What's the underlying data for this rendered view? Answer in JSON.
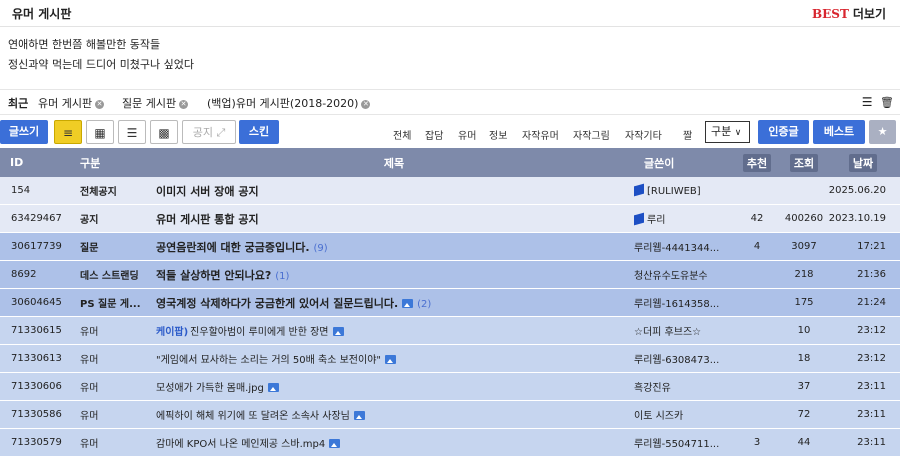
{
  "header": {
    "title": "유머 게시판",
    "best_label": "BEST",
    "more_label": "더보기"
  },
  "best_links": [
    "연애하면 한번쯤 해볼만한 동작들",
    "정신과약 먹는데 드디어 미쳤구나 싶었다"
  ],
  "recent": {
    "label": "최근",
    "tabs": [
      "유머 게시판",
      "질문 게시판",
      "(백업)유머 게시판(2018-2020)"
    ]
  },
  "toolbar": {
    "write_label": "글쓰기",
    "notice_label": "공지",
    "skin_label": "스킨",
    "categories": [
      "전체",
      "잡담",
      "유머",
      "정보",
      "자작유머",
      "자작그림",
      "자작기타",
      "짤"
    ],
    "select_value": "구분",
    "cert_label": "인증글",
    "best_label": "베스트"
  },
  "table": {
    "headers": {
      "id": "ID",
      "cat": "구분",
      "subject": "제목",
      "writer": "글쓴이",
      "recommend": "추천",
      "views": "조회",
      "date": "날짜"
    },
    "rows": [
      {
        "type": "notice",
        "id": "154",
        "cat": "전체공지",
        "tag": "",
        "subject": "이미지 서버 장애 공지",
        "comments": "",
        "image": false,
        "writer": "[RULIWEB]",
        "cube": true,
        "recommend": "",
        "views": "",
        "date": "2025.06.20"
      },
      {
        "type": "notice",
        "id": "63429467",
        "cat": "공지",
        "tag": "",
        "subject": "유머 게시판 통합 공지",
        "comments": "",
        "image": false,
        "writer": "루리",
        "cube": true,
        "recommend": "42",
        "views": "400260",
        "date": "2023.10.19"
      },
      {
        "type": "qna",
        "id": "30617739",
        "cat": "질문",
        "tag": "",
        "subject": "공연음란죄에 대한 궁금증입니다.",
        "comments": "(9)",
        "image": false,
        "writer": "루리웹-4441344...",
        "cube": false,
        "recommend": "4",
        "views": "3097",
        "date": "17:21"
      },
      {
        "type": "qna",
        "id": "8692",
        "cat": "데스 스트랜딩",
        "tag": "",
        "subject": "적들 살상하면 안되나요?",
        "comments": "(1)",
        "image": false,
        "writer": "청산유수도유분수",
        "cube": false,
        "recommend": "",
        "views": "218",
        "date": "21:36"
      },
      {
        "type": "qna",
        "id": "30604645",
        "cat": "PS 질문 게...",
        "tag": "",
        "subject": "영국계정 삭제하다가 궁금한게 있어서 질문드립니다.",
        "comments": "(2)",
        "image": true,
        "writer": "루리웹-1614358...",
        "cube": false,
        "recommend": "",
        "views": "175",
        "date": "21:24"
      },
      {
        "type": "normal",
        "id": "71330615",
        "cat": "유머",
        "tag": "케이팝)",
        "subject": "진우할아범이 루미에게 반한 장면",
        "comments": "",
        "image": true,
        "writer": "☆더피 후브즈☆",
        "cube": false,
        "recommend": "",
        "views": "10",
        "date": "23:12"
      },
      {
        "type": "normal",
        "id": "71330613",
        "cat": "유머",
        "tag": "",
        "subject": "\"게임에서 묘사하는 소리는 거의 50배 축소 보전이야\"",
        "comments": "",
        "image": true,
        "writer": "루리웹-6308473...",
        "cube": false,
        "recommend": "",
        "views": "18",
        "date": "23:12"
      },
      {
        "type": "normal",
        "id": "71330606",
        "cat": "유머",
        "tag": "",
        "subject": "모성애가 가득한 몸매.jpg",
        "comments": "",
        "image": true,
        "writer": "흑강진유",
        "cube": false,
        "recommend": "",
        "views": "37",
        "date": "23:11"
      },
      {
        "type": "normal",
        "id": "71330586",
        "cat": "유머",
        "tag": "",
        "subject": "에픽하이 해체 위기에 또 달려온 소속사 사장님",
        "comments": "",
        "image": true,
        "writer": "이토 시즈카",
        "cube": false,
        "recommend": "",
        "views": "72",
        "date": "23:11"
      },
      {
        "type": "normal",
        "id": "71330579",
        "cat": "유머",
        "tag": "",
        "subject": "감마에 KPO서 나온 메인제공 스바.mp4",
        "comments": "",
        "image": true,
        "writer": "루리웹-5504711...",
        "cube": false,
        "recommend": "3",
        "views": "44",
        "date": "23:11"
      }
    ]
  }
}
